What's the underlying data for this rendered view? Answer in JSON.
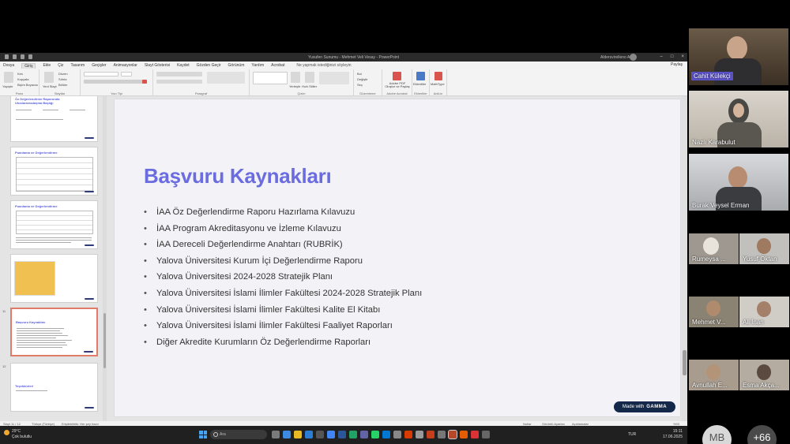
{
  "window": {
    "doc_title": "Yusufen Sunumu - Mehmet Veli Vesay - PowerPoint",
    "user_name": "Aldersvirelleno Admt"
  },
  "menu": {
    "tabs": [
      "Dosya",
      "Giriş",
      "Ekle",
      "Çiz",
      "Tasarım",
      "Geçişler",
      "Animasyonlar",
      "Slayt Gösterisi",
      "Kaydet",
      "Gözden Geçir",
      "Görünüm",
      "Yardım",
      "Acrobat"
    ],
    "tell_me": "Ne yapmak istediğinizi söyleyin",
    "share": "Paylaş"
  },
  "ribbon": {
    "groups": [
      "Pano",
      "Slaytlar",
      "Yazı Tipi",
      "Paragraf",
      "Çizim",
      "Düzenleme",
      "Adobe Acrobat",
      "Eklentiler",
      "Add-in"
    ],
    "labels": {
      "paste": "Yapıştır",
      "cut": "Kes",
      "copy": "Kopyala",
      "format_painter": "Biçim Boyacısı",
      "new_slide": "Yeni Slayt",
      "layout": "Düzen",
      "reset": "Sıfırla",
      "section": "Bölüm",
      "arrange": "Yerleştir",
      "quick_styles": "Hızlı Stiller",
      "find": "Bul",
      "replace": "Değiştir",
      "select": "Seç",
      "acrobat": "Adobe PDF Oluştur ve Paylaş",
      "addins": "Eklentiler",
      "mathtype": "MathType"
    }
  },
  "thumbnails": [
    {
      "num": "",
      "title": "Öz Değerlendirme Raporunda Uluslararasılaşma Başlığı"
    },
    {
      "num": "",
      "title": "Puanlama ve Değerlendirme"
    },
    {
      "num": "",
      "title": "Puanlama ve Değerlendirme"
    },
    {
      "num": "",
      "title": ""
    },
    {
      "num": "11",
      "title": "Başvuru Kaynakları"
    },
    {
      "num": "12",
      "title": "Teşekkürler!"
    }
  ],
  "slide": {
    "title": "Başvuru Kaynakları",
    "items": [
      "İAA Öz Değerlendirme Raporu Hazırlama Kılavuzu",
      "İAA Program Akreditasyonu ve İzleme Kılavuzu",
      "İAA Dereceli Değerlendirme Anahtarı (RUBRİK)",
      "Yalova Üniversitesi Kurum İçi Değerlendirme Raporu",
      "Yalova Üniversitesi 2024-2028 Stratejik Planı",
      "Yalova Üniversitesi İslami İlimler Fakültesi 2024-2028 Stratejik Planı",
      "Yalova Üniversitesi İslami İlimler Fakültesi Kalite El Kitabı",
      "Yalova Üniversitesi İslami İlimler Fakültesi Faaliyet Raporları",
      "Diğer Akredite Kurumların Öz Değerlendirme Raporları"
    ],
    "badge_prefix": "Made with",
    "badge_brand": "GAMMA"
  },
  "statusbar": {
    "slide_info": "Slayt 11 / 12",
    "language": "Türkçe (Türkiye)",
    "accessibility": "Erişilebilirlik: Her şey hazır",
    "notes": "Notlar",
    "comments": "Görüntü Ayarları",
    "view": "Açıklamalar",
    "zoom": "%93"
  },
  "taskbar": {
    "temp": "29°C",
    "weather": "Çok bulutlu",
    "search": "Ara",
    "lang": "TUR",
    "time": "15:11",
    "date": "17.06.2025"
  },
  "participants": [
    {
      "name": "Cahit Külekçi",
      "active": true
    },
    {
      "name": "Nazlı Karabulut"
    },
    {
      "name": "Burak Veysel Erman"
    },
    {
      "name": "Rumeysa ..."
    },
    {
      "name": "Yusuf Oktan"
    },
    {
      "name": "Mehmet V..."
    },
    {
      "name": "Ali İnan"
    },
    {
      "name": "Avnullah E..."
    },
    {
      "name": "Esma Akça..."
    }
  ],
  "bubbles": {
    "initials": "MB",
    "more": "+66"
  }
}
